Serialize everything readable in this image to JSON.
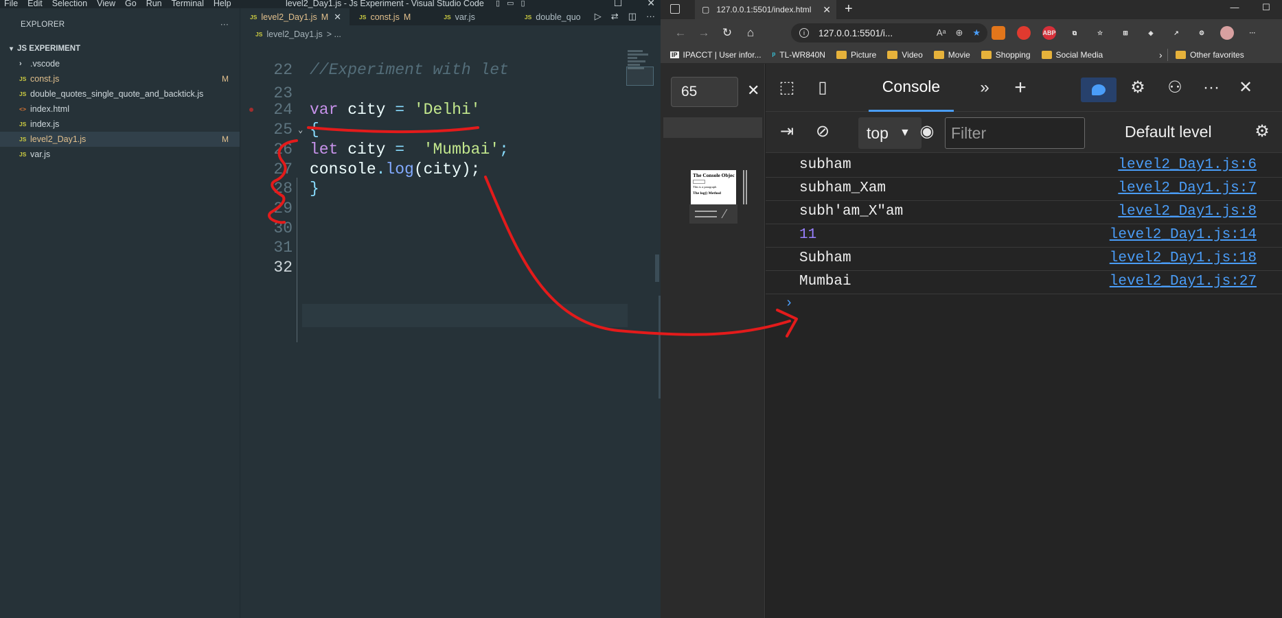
{
  "vscode": {
    "menu": [
      "File",
      "Edit",
      "Selection",
      "View",
      "Go",
      "Run",
      "Terminal",
      "Help"
    ],
    "window_title": "level2_Day1.js - Js Experiment - Visual Studio Code",
    "sidebar": {
      "title": "EXPLORER",
      "more": "···",
      "section": "JS EXPERIMENT",
      "items": [
        {
          "icon": "folder",
          "label": ".vscode",
          "badge": ""
        },
        {
          "icon": "JS",
          "label": "const.js",
          "badge": "M"
        },
        {
          "icon": "JS",
          "label": "double_quotes_single_quote_and_backtick.js",
          "badge": ""
        },
        {
          "icon": "<>",
          "label": "index.html",
          "badge": ""
        },
        {
          "icon": "JS",
          "label": "index.js",
          "badge": ""
        },
        {
          "icon": "JS",
          "label": "level2_Day1.js",
          "badge": "M"
        },
        {
          "icon": "JS",
          "label": "var.js",
          "badge": ""
        }
      ]
    },
    "tabs": [
      {
        "label": "level2_Day1.js",
        "badge": "M",
        "close": "✕"
      },
      {
        "label": "const.js",
        "badge": "M"
      },
      {
        "label": "var.js",
        "badge": ""
      },
      {
        "label": "double_quo",
        "badge": ""
      }
    ],
    "breadcrumb": {
      "file": "level2_Day1.js",
      "rest": "> ..."
    },
    "lines": [
      {
        "n": "22",
        "text": "//Experiment with let"
      },
      {
        "n": "23",
        "text": ""
      },
      {
        "n": "24",
        "kw": "var",
        "name": " city ",
        "op": "=",
        "str": " 'Delhi'"
      },
      {
        "n": "25",
        "text": "{"
      },
      {
        "n": "26",
        "kw": "let",
        "name": " city ",
        "op": "=",
        "str": "  'Mumbai'",
        "end": ";"
      },
      {
        "n": "27",
        "obj": "console",
        "dot": ".",
        "fn": "log",
        "args": "(city);"
      },
      {
        "n": "28",
        "text": "}"
      },
      {
        "n": "29",
        "text": ""
      },
      {
        "n": "30",
        "text": ""
      },
      {
        "n": "31",
        "text": ""
      },
      {
        "n": "32",
        "text": ""
      }
    ]
  },
  "browser": {
    "tab_title": "127.0.0.1:5501/index.html",
    "tab_close": "✕",
    "new_tab": "+",
    "address": "127.0.0.1:5501/i...",
    "bookmarks": [
      {
        "icon": "ip",
        "label": "IPACCT | User infor..."
      },
      {
        "icon": "tp",
        "label": "TL-WR840N"
      },
      {
        "icon": "folder",
        "label": "Picture"
      },
      {
        "icon": "folder",
        "label": "Video"
      },
      {
        "icon": "folder",
        "label": "Movie"
      },
      {
        "icon": "folder",
        "label": "Shopping"
      },
      {
        "icon": "folder",
        "label": "Social Media"
      }
    ],
    "bookmarks_more": "›",
    "other_favorites": "Other favorites",
    "extensions": [
      {
        "label": "",
        "color": "#e2761b"
      },
      {
        "label": "",
        "color": "#e03a2f"
      },
      {
        "label": "ABP",
        "color": "#d6303a"
      }
    ],
    "page": {
      "zoom": "65",
      "zoom_close": "✕",
      "thumb_title": "The Console Objec",
      "thumb_line": "This is a paragraph",
      "thumb_heading": "The log() Method"
    },
    "devtools": {
      "tab": "Console",
      "context": "top",
      "filter_placeholder": "Filter",
      "level": "Default level",
      "messages": [
        {
          "value": "subham",
          "source": "level2_Day1.js:6",
          "type": "string"
        },
        {
          "value": "subham_Xam",
          "source": "level2_Day1.js:7",
          "type": "string"
        },
        {
          "value": "subh'am_X\"am",
          "source": "level2_Day1.js:8",
          "type": "string"
        },
        {
          "value": "11",
          "source": "level2_Day1.js:14",
          "type": "number"
        },
        {
          "value": "Subham",
          "source": "level2_Day1.js:18",
          "type": "string"
        },
        {
          "value": "Mumbai",
          "source": "level2_Day1.js:27",
          "type": "string"
        }
      ],
      "prompt": "›"
    }
  },
  "colors": {
    "annotation": "#e31b1b",
    "accent": "#4a9df8"
  }
}
